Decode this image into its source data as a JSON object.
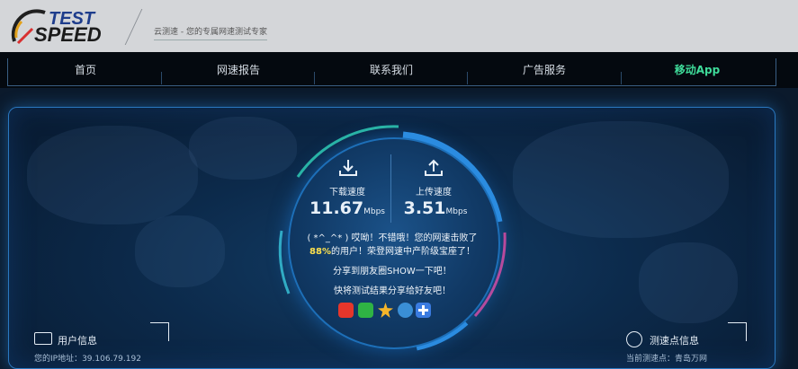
{
  "header": {
    "logo_text_top": "TEST",
    "logo_text_bottom": "SPEED",
    "tagline": "云测速 - 您的专属网速测试专家"
  },
  "nav": {
    "items": [
      {
        "label": "首页"
      },
      {
        "label": "网速报告"
      },
      {
        "label": "联系我们"
      },
      {
        "label": "广告服务"
      },
      {
        "label": "移动App"
      }
    ]
  },
  "result": {
    "download_label": "下载速度",
    "download_value": "11.67",
    "download_unit": "Mbps",
    "upload_label": "上传速度",
    "upload_value": "3.51",
    "upload_unit": "Mbps",
    "message_line1": "( *^_^* ) 哎呦！不错哦！您的网速击败了",
    "percent": "88%",
    "message_line2_rest": "的用户！荣登网速中产阶级宝座了！",
    "share_line1": "分享到朋友圈SHOW一下吧！",
    "share_line2": "快将测试结果分享给好友吧！"
  },
  "share_icons": [
    {
      "name": "weibo-icon",
      "color": "#e6362b"
    },
    {
      "name": "wechat-icon",
      "color": "#2fb344"
    },
    {
      "name": "qzone-icon",
      "color": "#f5b52a"
    },
    {
      "name": "tencent-weibo-icon",
      "color": "#3a8fd6"
    },
    {
      "name": "more-share-icon",
      "color": "#3a7be0"
    }
  ],
  "panels": {
    "user_info_title": "用户信息",
    "user_info_sub": "您的IP地址：39.106.79.192",
    "test_point_title": "测速点信息",
    "test_point_sub": "当前测速点：青岛万网"
  },
  "colors": {
    "accent_green": "#3fdc9a",
    "accent_blue": "#2a78c0",
    "percent_yellow": "#ffe14d"
  }
}
